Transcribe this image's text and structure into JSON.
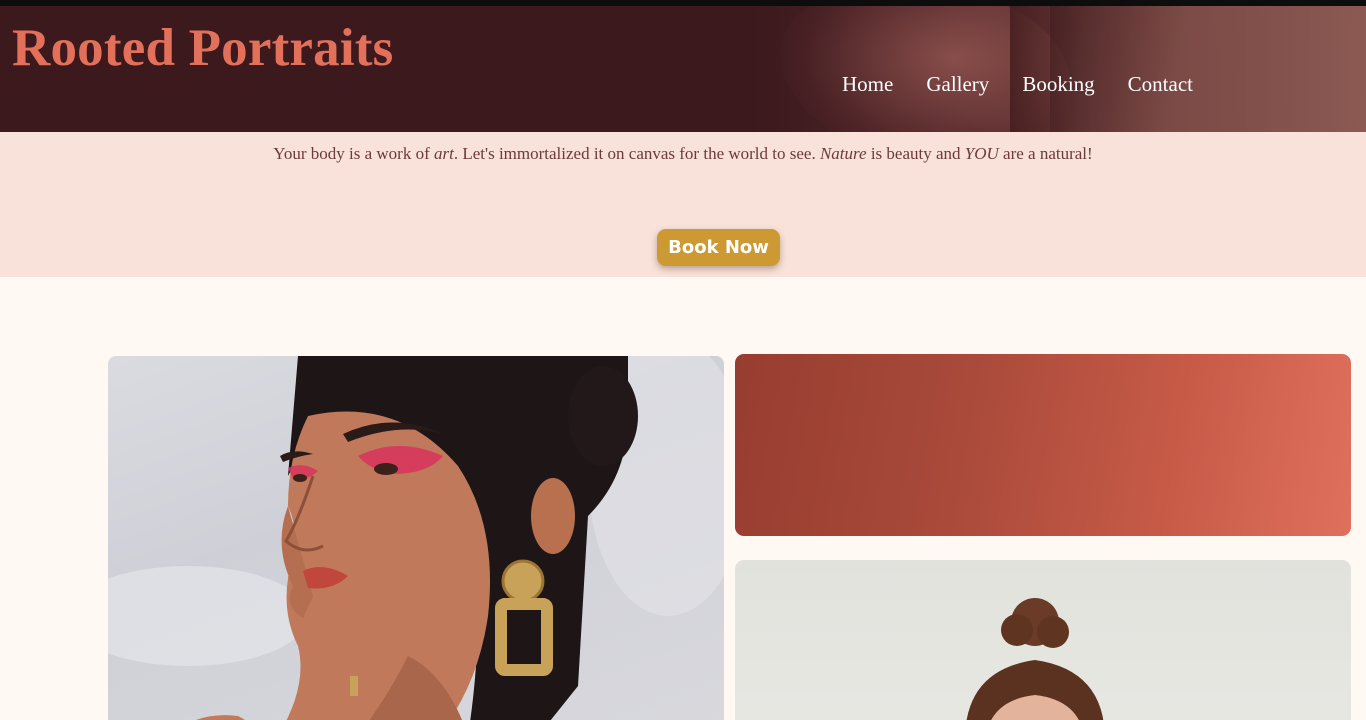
{
  "site": {
    "brand": "Rooted Portraits"
  },
  "nav": {
    "items": [
      {
        "label": "Home"
      },
      {
        "label": "Gallery"
      },
      {
        "label": "Booking"
      },
      {
        "label": "Contact"
      }
    ]
  },
  "hero": {
    "tagline": {
      "part1": "Your body is a work of ",
      "em1": "art",
      "part2": ". Let's immortalized it on canvas for the world to see. ",
      "em2": "Nature",
      "part3": " is beauty and ",
      "em3": "YOU",
      "part4": " are a natural!"
    },
    "cta_label": "Book Now"
  },
  "colors": {
    "header_bg": "#3b191d",
    "brand": "#e3705b",
    "hero_bg": "#f8e2d9",
    "cta_bg": "#cc9932",
    "swatch_start": "#973d30",
    "swatch_end": "#e0705e",
    "page_bg": "#fff8f3"
  }
}
